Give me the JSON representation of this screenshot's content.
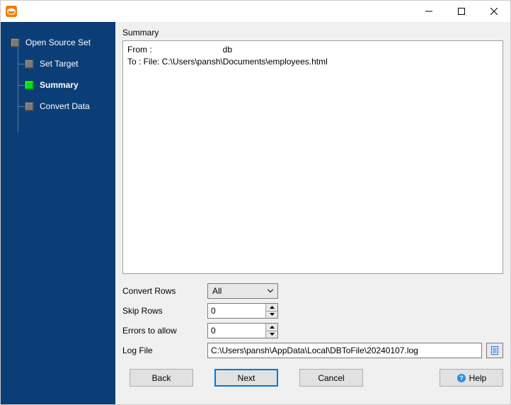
{
  "sidebar": {
    "items": [
      {
        "label": "Open Source Set"
      },
      {
        "label": "Set Target"
      },
      {
        "label": "Summary"
      },
      {
        "label": "Convert Data"
      }
    ]
  },
  "panel": {
    "title": "Summary",
    "text": "From :                              db\nTo : File: C:\\Users\\pansh\\Documents\\employees.html"
  },
  "form": {
    "convert_rows_label": "Convert Rows",
    "convert_rows_value": "All",
    "skip_rows_label": "Skip Rows",
    "skip_rows_value": "0",
    "errors_label": "Errors to allow",
    "errors_value": "0",
    "log_label": "Log File",
    "log_value": "C:\\Users\\pansh\\AppData\\Local\\DBToFile\\20240107.log"
  },
  "buttons": {
    "back": "Back",
    "next": "Next",
    "cancel": "Cancel",
    "help": "Help"
  }
}
